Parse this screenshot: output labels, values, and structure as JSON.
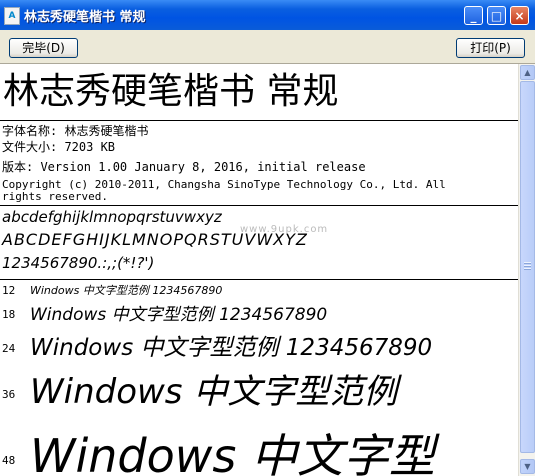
{
  "window": {
    "title": "林志秀硬笔楷书 常规",
    "icon": "font-file-icon",
    "controls": {
      "minimize": "_",
      "maximize": "□",
      "close": "×"
    }
  },
  "toolbar": {
    "done_label": "完毕(D)",
    "print_label": "打印(P)"
  },
  "content": {
    "heading": "林志秀硬笔楷书 常规",
    "info": {
      "font_name": "字体名称: 林志秀硬笔楷书",
      "file_size": "文件大小: 7203 KB",
      "version": "版本: Version 1.00 January 8, 2016, initial release",
      "copyright_line1": "Copyright (c) 2010-2011, Changsha SinoType Technology Co., Ltd.  All",
      "copyright_line2": "rights reserved."
    },
    "charset": {
      "lowercase": "abcdefghijklmnopqrstuvwxyz",
      "uppercase": "ABCDEFGHIJKLMNOPQRSTUVWXYZ",
      "digits_symbols": "1234567890.:,;(*!?')"
    },
    "watermark": "www.9upk.com",
    "samples": [
      {
        "size": "12",
        "text": "Windows 中文字型范例 1234567890"
      },
      {
        "size": "18",
        "text": "Windows 中文字型范例 1234567890"
      },
      {
        "size": "24",
        "text": "Windows 中文字型范例 1234567890"
      },
      {
        "size": "36",
        "text": "Windows 中文字型范例"
      },
      {
        "size": "48",
        "text": "Windows 中文字型"
      }
    ]
  },
  "colors": {
    "titlebar": "#0054e3",
    "toolbar_bg": "#ece9d8",
    "close_button": "#c4391a"
  }
}
